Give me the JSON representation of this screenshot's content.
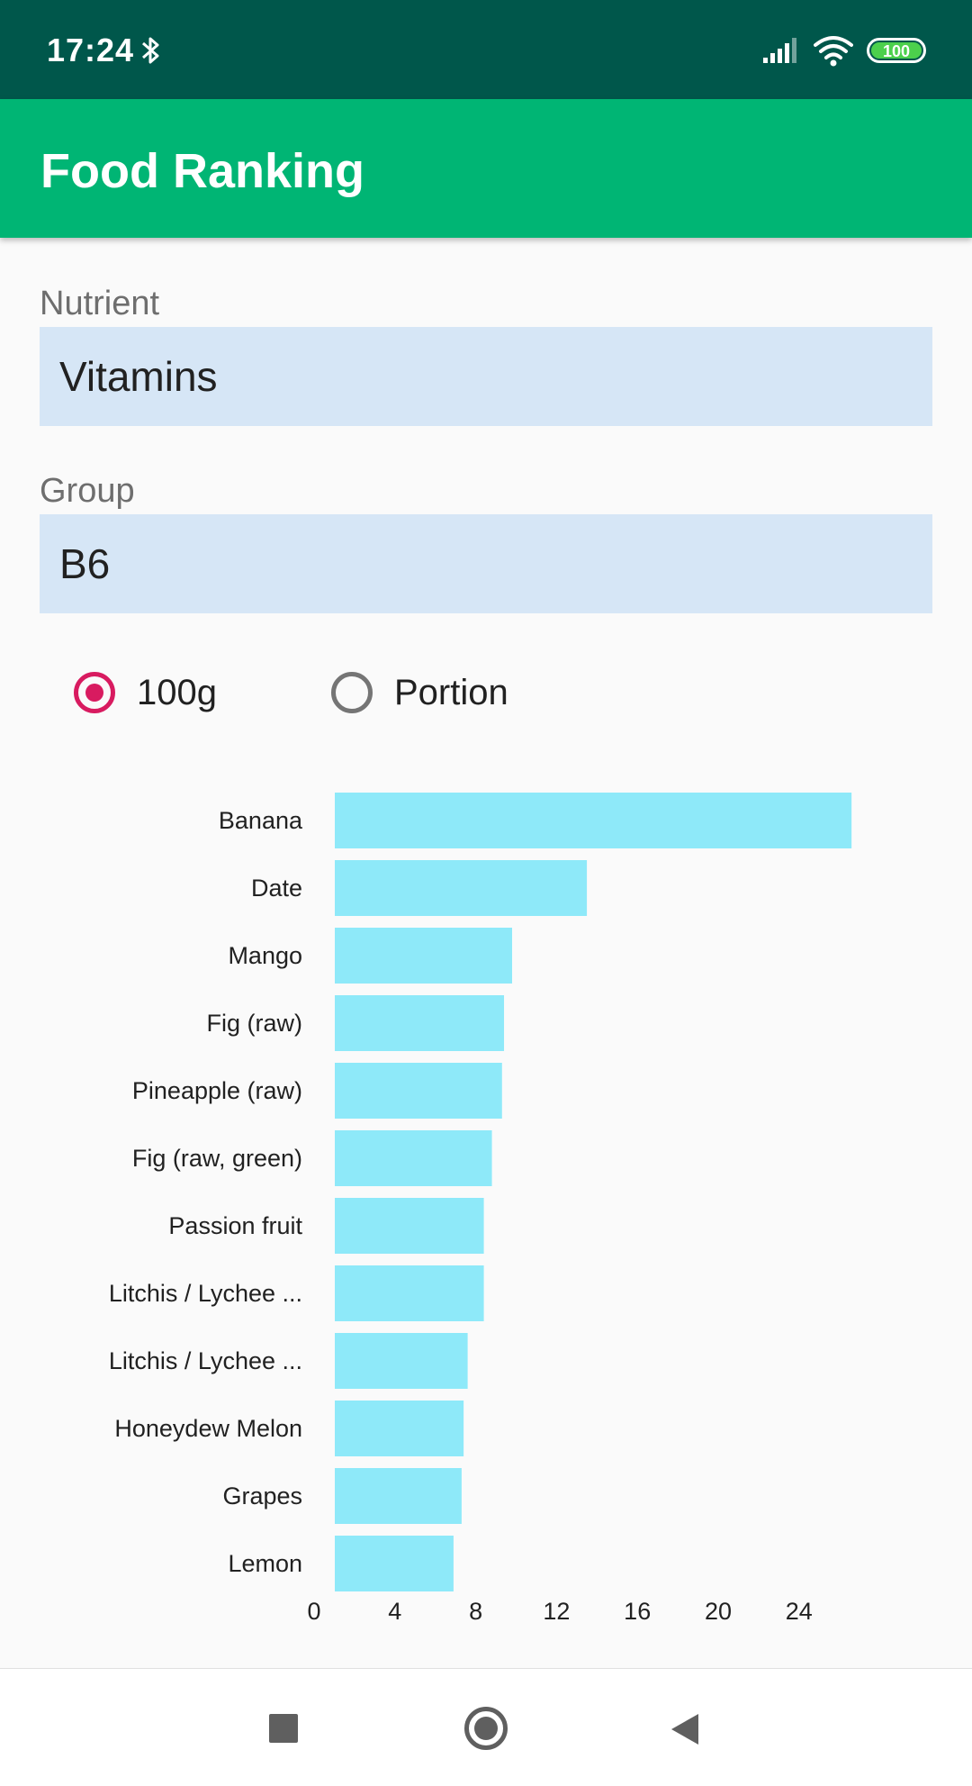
{
  "status_bar": {
    "time": "17:24",
    "battery": "100",
    "icons": [
      "bluetooth-icon",
      "signal-icon",
      "wifi-icon",
      "battery-icon"
    ]
  },
  "app_bar": {
    "title": "Food Ranking"
  },
  "form": {
    "nutrient_label": "Nutrient",
    "nutrient_value": "Vitamins",
    "group_label": "Group",
    "group_value": "B6"
  },
  "radio": {
    "option_100g": "100g",
    "option_portion": "Portion",
    "selected": "100g"
  },
  "colors": {
    "status_bar": "#00574b",
    "app_bar": "#00b574",
    "accent": "#d81b60",
    "field_bg": "#d6e6f6",
    "bar": "#8ee9f9"
  },
  "chart_data": {
    "type": "bar",
    "orientation": "horizontal",
    "categories": [
      "Banana",
      "Date",
      "Mango",
      "Fig (raw)",
      "Pineapple (raw)",
      "Fig (raw, green)",
      "Passion fruit",
      "Litchis / Lychee ...",
      "Litchis / Lychee ...",
      "Honeydew Melon",
      "Grapes",
      "Lemon"
    ],
    "values": [
      26.6,
      13.5,
      9.8,
      9.4,
      9.3,
      8.8,
      8.4,
      8.4,
      7.6,
      7.4,
      7.3,
      6.9
    ],
    "xticks": [
      "0",
      "4",
      "8",
      "12",
      "16",
      "20",
      "24"
    ],
    "xlim": [
      1,
      27
    ],
    "grid": false,
    "legend": "none",
    "title": "",
    "xlabel": "",
    "ylabel": ""
  },
  "nav_bar": {
    "icons": [
      "recents-icon",
      "home-icon",
      "back-icon"
    ]
  }
}
